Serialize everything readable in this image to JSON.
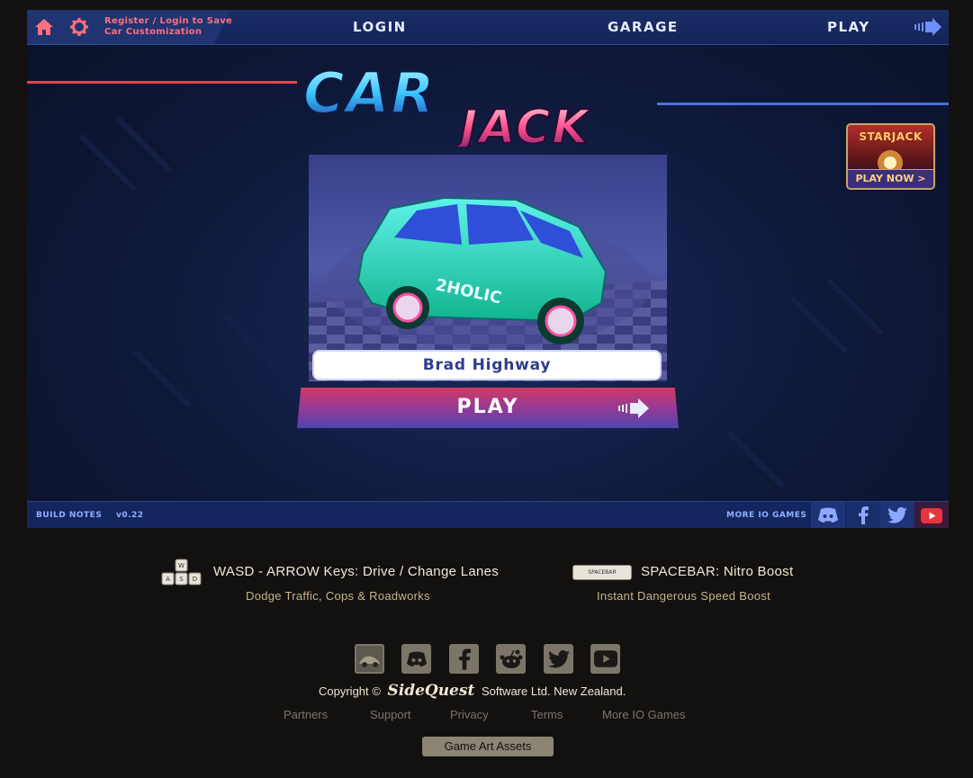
{
  "topbar": {
    "register_text_line1": "Register / Login to Save",
    "register_text_line2": "Car Customization",
    "login_label": "LOGIN",
    "garage_label": "GARAGE",
    "play_label": "PLAY"
  },
  "logo": {
    "line1": "CAR",
    "line2": "JACK"
  },
  "ad": {
    "title": "STARJACK",
    "cta": "PLAY NOW >"
  },
  "car": {
    "name": "Brad Highway",
    "decal": "2HOLIC"
  },
  "play_button": {
    "label": "PLAY"
  },
  "bottombar": {
    "build_notes": "BUILD NOTES",
    "version": "v0.22",
    "more_games": "MORE IO GAMES"
  },
  "instructions": {
    "drive_text": "WASD - ARROW Keys: Drive / Change Lanes",
    "drive_sub": "Dodge Traffic, Cops & Roadworks",
    "boost_text": "SPACEBAR: Nitro Boost",
    "boost_sub": "Instant Dangerous Speed Boost",
    "spacebar_key": "SPACEBAR",
    "keys": [
      "W",
      "A",
      "S",
      "D"
    ]
  },
  "footer": {
    "copyright_prefix": "Copyright ©",
    "brand": "SideQuest",
    "copyright_suffix": "Software Ltd. New Zealand.",
    "links": [
      "Partners",
      "Support",
      "Privacy",
      "Terms",
      "More IO Games"
    ],
    "assets_button": "Game Art Assets"
  },
  "colors": {
    "accent_red": "#ff6f7e",
    "bar_blue": "#142660",
    "footer_text": "#f1e7d4"
  }
}
